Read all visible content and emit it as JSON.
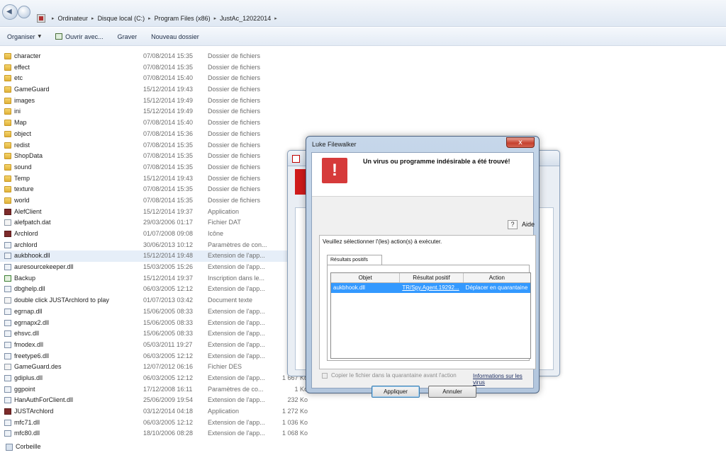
{
  "breadcrumb": {
    "items": [
      "Ordinateur",
      "Disque local (C:)",
      "Program Files (x86)",
      "JustAc_12022014"
    ]
  },
  "toolbar": {
    "organiser": "Organiser",
    "ouvrir": "Ouvrir avec...",
    "graver": "Graver",
    "nouveau": "Nouveau dossier"
  },
  "files": [
    {
      "name": "character",
      "date": "07/08/2014 15:35",
      "type": "Dossier de fichiers",
      "size": "",
      "icon": "folder"
    },
    {
      "name": "effect",
      "date": "07/08/2014 15:35",
      "type": "Dossier de fichiers",
      "size": "",
      "icon": "folder"
    },
    {
      "name": "etc",
      "date": "07/08/2014 15:40",
      "type": "Dossier de fichiers",
      "size": "",
      "icon": "folder"
    },
    {
      "name": "GameGuard",
      "date": "15/12/2014 19:43",
      "type": "Dossier de fichiers",
      "size": "",
      "icon": "folder"
    },
    {
      "name": "images",
      "date": "15/12/2014 19:49",
      "type": "Dossier de fichiers",
      "size": "",
      "icon": "folder"
    },
    {
      "name": "ini",
      "date": "15/12/2014 19:49",
      "type": "Dossier de fichiers",
      "size": "",
      "icon": "folder"
    },
    {
      "name": "Map",
      "date": "07/08/2014 15:40",
      "type": "Dossier de fichiers",
      "size": "",
      "icon": "folder"
    },
    {
      "name": "object",
      "date": "07/08/2014 15:36",
      "type": "Dossier de fichiers",
      "size": "",
      "icon": "folder"
    },
    {
      "name": "redist",
      "date": "07/08/2014 15:35",
      "type": "Dossier de fichiers",
      "size": "",
      "icon": "folder"
    },
    {
      "name": "ShopData",
      "date": "07/08/2014 15:35",
      "type": "Dossier de fichiers",
      "size": "",
      "icon": "folder"
    },
    {
      "name": "sound",
      "date": "07/08/2014 15:35",
      "type": "Dossier de fichiers",
      "size": "",
      "icon": "folder"
    },
    {
      "name": "Temp",
      "date": "15/12/2014 19:43",
      "type": "Dossier de fichiers",
      "size": "",
      "icon": "folder"
    },
    {
      "name": "texture",
      "date": "07/08/2014 15:35",
      "type": "Dossier de fichiers",
      "size": "",
      "icon": "folder"
    },
    {
      "name": "world",
      "date": "07/08/2014 15:35",
      "type": "Dossier de fichiers",
      "size": "",
      "icon": "folder"
    },
    {
      "name": "AlefClient",
      "date": "15/12/2014 19:37",
      "type": "Application",
      "size": "",
      "icon": "app"
    },
    {
      "name": "alefpatch.dat",
      "date": "29/03/2006 01:17",
      "type": "Fichier DAT",
      "size": "",
      "icon": "file"
    },
    {
      "name": "Archlord",
      "date": "01/07/2008 09:08",
      "type": "Icône",
      "size": "",
      "icon": "app"
    },
    {
      "name": "archlord",
      "date": "30/06/2013 10:12",
      "type": "Paramètres de con...",
      "size": "",
      "icon": "dll"
    },
    {
      "name": "aukbhook.dll",
      "date": "15/12/2014 19:48",
      "type": "Extension de l'app...",
      "size": "",
      "icon": "dll"
    },
    {
      "name": "auresourcekeeper.dll",
      "date": "15/03/2005 15:26",
      "type": "Extension de l'app...",
      "size": "",
      "icon": "dll"
    },
    {
      "name": "Backup",
      "date": "15/12/2014 19:37",
      "type": "Inscription dans le...",
      "size": "",
      "icon": "reg"
    },
    {
      "name": "dbghelp.dll",
      "date": "06/03/2005 12:12",
      "type": "Extension de l'app...",
      "size": "",
      "icon": "dll"
    },
    {
      "name": "double click JUSTArchlord to play",
      "date": "01/07/2013 03:42",
      "type": "Document texte",
      "size": "",
      "icon": "file"
    },
    {
      "name": "egrnap.dll",
      "date": "15/06/2005 08:33",
      "type": "Extension de l'app...",
      "size": "",
      "icon": "dll"
    },
    {
      "name": "egrnapx2.dll",
      "date": "15/06/2005 08:33",
      "type": "Extension de l'app...",
      "size": "",
      "icon": "dll"
    },
    {
      "name": "ehsvc.dll",
      "date": "15/06/2005 08:33",
      "type": "Extension de l'app...",
      "size": "",
      "icon": "dll"
    },
    {
      "name": "fmodex.dll",
      "date": "05/03/2011 19:27",
      "type": "Extension de l'app...",
      "size": "",
      "icon": "dll"
    },
    {
      "name": "freetype6.dll",
      "date": "06/03/2005 12:12",
      "type": "Extension de l'app...",
      "size": "",
      "icon": "dll"
    },
    {
      "name": "GameGuard.des",
      "date": "12/07/2012 06:16",
      "type": "Fichier DES",
      "size": "",
      "icon": "file"
    },
    {
      "name": "gdiplus.dll",
      "date": "06/03/2005 12:12",
      "type": "Extension de l'app...",
      "size": "1 667 Ko",
      "icon": "dll"
    },
    {
      "name": "ggpoint",
      "date": "17/12/2008 16:11",
      "type": "Paramètres de co...",
      "size": "1 Ko",
      "icon": "dll"
    },
    {
      "name": "HanAuthForClient.dll",
      "date": "25/06/2009 19:54",
      "type": "Extension de l'app...",
      "size": "232 Ko",
      "icon": "dll"
    },
    {
      "name": "JUSTArchlord",
      "date": "03/12/2014 04:18",
      "type": "Application",
      "size": "1 272 Ko",
      "icon": "app"
    },
    {
      "name": "mfc71.dll",
      "date": "06/03/2005 12:12",
      "type": "Extension de l'app...",
      "size": "1 036 Ko",
      "icon": "dll"
    },
    {
      "name": "mfc80.dll",
      "date": "18/10/2006 08:28",
      "type": "Extension de l'app...",
      "size": "1 068 Ko",
      "icon": "dll"
    }
  ],
  "dialog": {
    "title": "Luke Filewalker",
    "heading": "Un virus ou programme indésirable a été trouvé!",
    "help": "Aide",
    "help_icon": "?",
    "group_label": "Veuillez sélectionner l'(les) action(s) à exécuter.",
    "tab": "Résultats positifs",
    "columns": [
      "Objet",
      "Résultat positif",
      "Action"
    ],
    "row": {
      "object": "aukbhook.dll",
      "result": "TR/Spy.Agent.19292...",
      "action": "Déplacer en quarantaine"
    },
    "checkbox": "Copier le fichier dans la quarantaine avant l'action",
    "info_link": "Informations sur les virus",
    "apply": "Appliquer",
    "cancel": "Annuler",
    "close_glyph": "x",
    "warn_glyph": "!"
  },
  "bottom": {
    "corbeille": "Corbeille"
  },
  "colors": {
    "selection": "#3399ff",
    "warning": "#d63a3a",
    "close": "#c6412f"
  }
}
